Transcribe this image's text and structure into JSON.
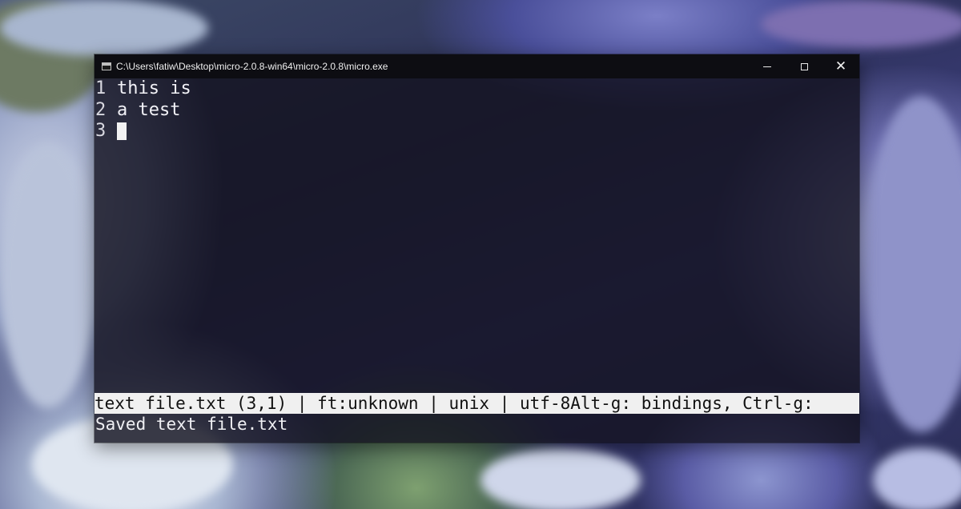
{
  "window": {
    "title": "C:\\Users\\fatiw\\Desktop\\micro-2.0.8-win64\\micro-2.0.8\\micro.exe",
    "minimize": "—",
    "maximize": "☐",
    "close": "✕"
  },
  "editor": {
    "lines": [
      {
        "number": "1",
        "text": "this is"
      },
      {
        "number": "2",
        "text": "a test"
      },
      {
        "number": "3",
        "text": ""
      }
    ]
  },
  "status_bar": {
    "text": "text file.txt (3,1) | ft:unknown | unix | utf-8Alt-g: bindings, Ctrl-g:"
  },
  "message": {
    "text": "Saved text file.txt"
  },
  "colors": {
    "status_bar_bg": "#f0f0f0",
    "title_bar_bg": "#0d0d12",
    "editor_bg": "#141220"
  }
}
